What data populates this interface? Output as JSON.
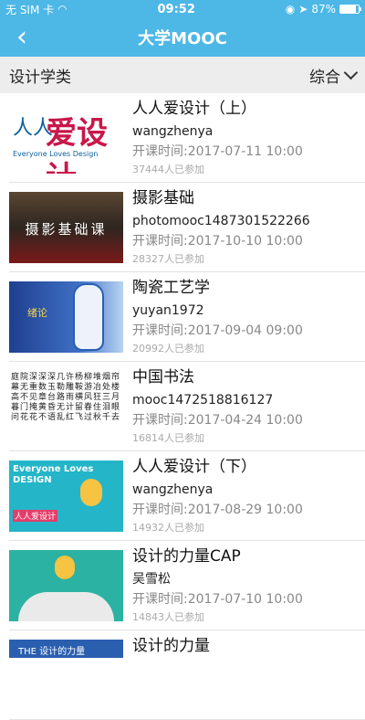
{
  "status_bar": {
    "carrier": "无 SIM 卡",
    "wifi_icon": "wifi-icon",
    "time": "09:52",
    "lock_icon": "orientation-lock-icon",
    "location_icon": "location-arrow-icon",
    "battery_percent_text": "87%",
    "battery_level": 0.87
  },
  "nav": {
    "back_icon": "chevron-left-icon",
    "title": "大学MOOC"
  },
  "filter": {
    "category": "设计学类",
    "sort_label": "综合",
    "sort_icon": "chevron-down-icon"
  },
  "courses": [
    {
      "name": "人人爱设计（上）",
      "teacher": "wangzhenya",
      "start_time": "开课时间:2017-07-11 10:00",
      "enrolled": "37444人已参加",
      "thumb_text_a": "人人",
      "thumb_text_b": "爱设计",
      "thumb_text_c": "Everyone Loves Design"
    },
    {
      "name": "摄影基础",
      "teacher": "photomooc1487301522266",
      "start_time": "开课时间:2017-10-10 10:00",
      "enrolled": "28327人已参加",
      "thumb_text": "摄影基础课"
    },
    {
      "name": "陶瓷工艺学",
      "teacher": "yuyan1972",
      "start_time": "开课时间:2017-09-04 09:00",
      "enrolled": "20992人已参加",
      "thumb_text": "绪论"
    },
    {
      "name": "中国书法",
      "teacher": "mooc1472518816127",
      "start_time": "开课时间:2017-04-24 10:00",
      "enrolled": "16814人已参加",
      "thumb_text": "庭院深深深几许杨柳堆烟帘幕无重数玉勒雕鞍游冶处楼高不见章台路雨横风狂三月暮门掩黄昏无计留春住泪眼问花花不语乱红飞过秋千去"
    },
    {
      "name": "人人爱设计（下）",
      "teacher": "wangzhenya",
      "start_time": "开课时间:2017-08-29 10:00",
      "enrolled": "14932人已参加",
      "thumb_text_a": "Everyone Loves DESIGN",
      "thumb_text_b": "人人爱设计"
    },
    {
      "name": "设计的力量CAP",
      "teacher": "吴雪松",
      "start_time": "开课时间:2017-07-10 10:00",
      "enrolled": "14843人已参加"
    },
    {
      "name": "设计的力量",
      "thumb_text": "THE 设计的力量"
    }
  ]
}
